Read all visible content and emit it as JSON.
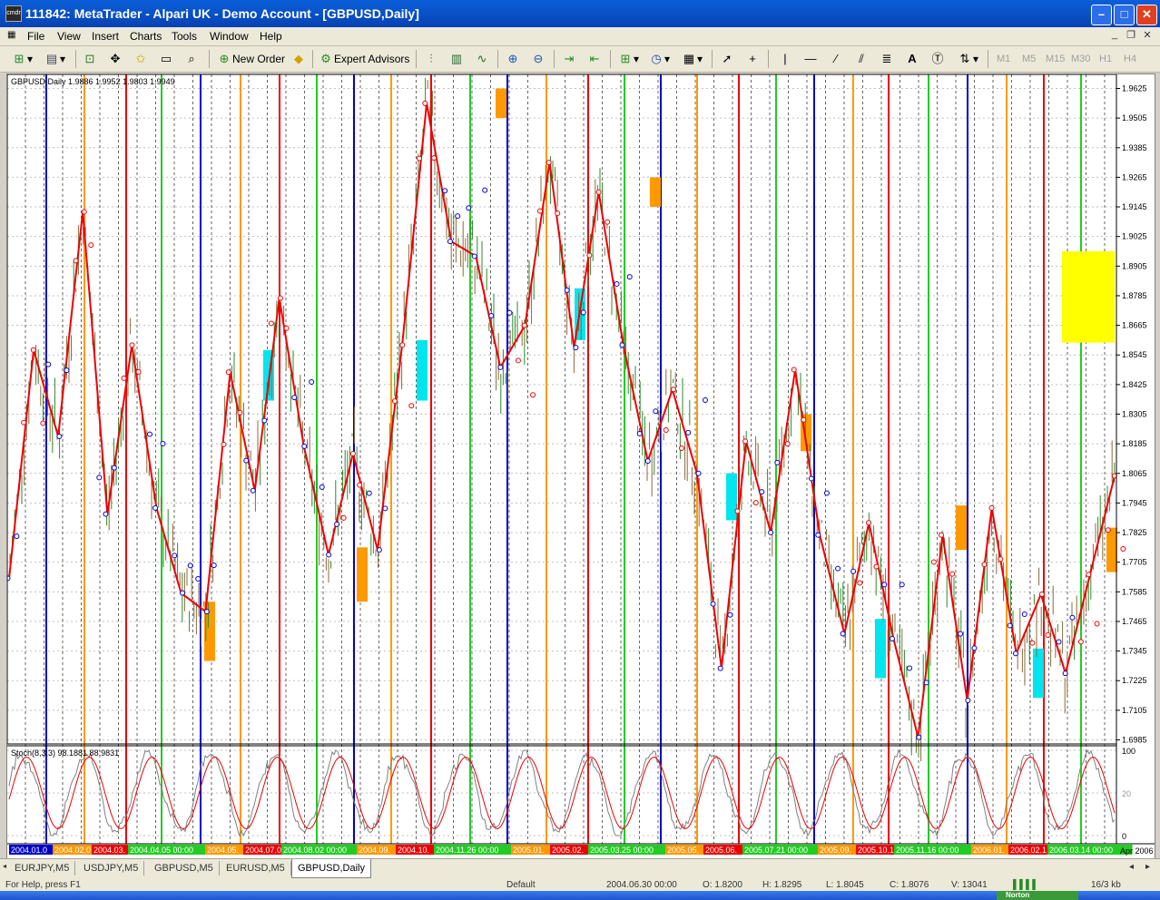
{
  "window": {
    "title": "111842: MetaTrader - Alpari UK - Demo Account - [GBPUSD,Daily]",
    "app_icon_text": "cmdr"
  },
  "menu": [
    "File",
    "View",
    "Insert",
    "Charts",
    "Tools",
    "Window",
    "Help"
  ],
  "toolbar": {
    "new_order": "New Order",
    "expert_advisors": "Expert Advisors",
    "timeframes": [
      "M1",
      "M5",
      "M15",
      "M30",
      "H1",
      "H4"
    ]
  },
  "chart": {
    "info": "GBPUSD,Daily  1.9886 1.9952 1.9803 1.9949",
    "stoch_label": "Stoch(8,3,3) 98.1881 88.9831",
    "price_axis": [
      "1.9625",
      "1.9505",
      "1.9385",
      "1.9265",
      "1.9145",
      "1.9025",
      "1.8905",
      "1.8785",
      "1.8665",
      "1.8545",
      "1.8425",
      "1.8305",
      "1.8185",
      "1.8065",
      "1.7945",
      "1.7825",
      "1.7705",
      "1.7585",
      "1.7465",
      "1.7345",
      "1.7225",
      "1.7105",
      "1.6985"
    ],
    "stoch_axis": [
      "100",
      "20",
      "0"
    ],
    "colors": {
      "red": "#ee0000",
      "blue": "#0000cc",
      "green": "#22cc22",
      "orange": "#ff9900",
      "cyan": "#00e5ee",
      "yellow": "#ffff00"
    },
    "date_labels": [
      {
        "text": "2004.01.0",
        "color": "#0000cc"
      },
      {
        "text": "2004.02.0",
        "color": "#ff9900"
      },
      {
        "text": "2004.03.",
        "color": "#ee0000"
      },
      {
        "text": "2004.04.05 00:00",
        "color": "#22cc22"
      },
      {
        "text": "2004.05.",
        "color": "#ff9900"
      },
      {
        "text": "2004.07.0",
        "color": "#ee0000"
      },
      {
        "text": "2004.08.02 00:00",
        "color": "#22cc22"
      },
      {
        "text": "2004.09.",
        "color": "#ff9900"
      },
      {
        "text": "2004.10.",
        "color": "#ee0000"
      },
      {
        "text": "2004.11.26 00:00",
        "color": "#22cc22"
      },
      {
        "text": "2005.01.",
        "color": "#ff9900"
      },
      {
        "text": "2005.02.",
        "color": "#ee0000"
      },
      {
        "text": "2005.03.25 00:00",
        "color": "#22cc22"
      },
      {
        "text": "2005.05.",
        "color": "#ff9900"
      },
      {
        "text": "2005.06.",
        "color": "#ee0000"
      },
      {
        "text": "2005.07.21 00:00",
        "color": "#22cc22"
      },
      {
        "text": "2005.09.",
        "color": "#ff9900"
      },
      {
        "text": "2005.10.1",
        "color": "#ee0000"
      },
      {
        "text": "2005.11.16 00:00",
        "color": "#22cc22"
      },
      {
        "text": "2006.01.",
        "color": "#ff9900"
      },
      {
        "text": "2006.02.1",
        "color": "#ee0000"
      },
      {
        "text": "2006.03.14 00:00",
        "color": "#22cc22"
      }
    ],
    "end_date": "Apr 2006",
    "zigzag": [
      1.764,
      1.8565,
      1.8215,
      1.9125,
      1.79,
      1.8585,
      1.7925,
      1.758,
      1.7505,
      1.8475,
      1.7995,
      1.8775,
      1.8175,
      1.7735,
      1.8145,
      1.7755,
      1.8585,
      1.9565,
      1.9005,
      1.8945,
      1.8495,
      1.8665,
      1.9325,
      1.8575,
      1.9205,
      1.8585,
      1.8115,
      1.8405,
      1.8065,
      1.7275,
      1.8195,
      1.7825,
      1.8485,
      1.7815,
      1.7415,
      1.7865,
      1.7395,
      1.6995,
      1.7815,
      1.7145,
      1.7925,
      1.7335,
      1.7575,
      1.7255,
      1.7655,
      1.8055
    ]
  },
  "tabs": [
    "EURJPY,M5",
    "USDJPY,M5",
    "GBPUSD,M5",
    "EURUSD,M5",
    "GBPUSD,Daily"
  ],
  "status": {
    "help": "For Help, press F1",
    "profile": "Default",
    "datetime": "2004.06.30 00:00",
    "open": "O: 1.8200",
    "high": "H: 1.8295",
    "low": "L: 1.8045",
    "close": "C: 1.8076",
    "volume": "V: 13041",
    "traffic": "16/3 kb"
  },
  "taskbar": {
    "start": "Norton"
  }
}
